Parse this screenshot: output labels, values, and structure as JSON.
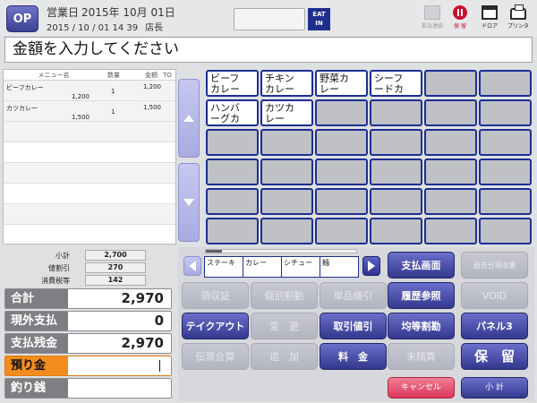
{
  "header": {
    "op_label": "OP",
    "business_day_label": "営業日",
    "business_day_value": "2015年 10月 01日",
    "datetime": "2015 / 10 / 01  14  39",
    "clerk_label": "店長",
    "eat_in_label": "EAT IN",
    "icons": [
      {
        "name": "emergency-contact",
        "label": "緊急連絡"
      },
      {
        "name": "hold",
        "label": "保 留"
      },
      {
        "name": "drawer",
        "label": "ドロア"
      },
      {
        "name": "printer",
        "label": "プリンタ"
      }
    ]
  },
  "prompt": "金額を入力してください",
  "order_list": {
    "columns": {
      "name": "メニュー名",
      "qty": "数量",
      "amount": "金額",
      "to": "TO"
    },
    "items": [
      {
        "name": "ビーフカレー",
        "unit_price": "1,200",
        "qty": "1",
        "amount": "1,200"
      },
      {
        "name": "カツカレー",
        "unit_price": "1,500",
        "qty": "1",
        "amount": "1,500"
      }
    ]
  },
  "menu_grid": {
    "items": [
      {
        "label": "ビーフ\nカレー"
      },
      {
        "label": "チキン\nカレー"
      },
      {
        "label": "野菜カ\nレー"
      },
      {
        "label": "シーフ\nードカ"
      },
      {
        "label": ""
      },
      {
        "label": ""
      },
      {
        "label": "ハンバ\nーグカ"
      },
      {
        "label": "カツカ\nレー"
      },
      {
        "label": ""
      },
      {
        "label": ""
      },
      {
        "label": ""
      },
      {
        "label": ""
      },
      {
        "label": ""
      },
      {
        "label": ""
      },
      {
        "label": ""
      },
      {
        "label": ""
      },
      {
        "label": ""
      },
      {
        "label": ""
      },
      {
        "label": ""
      },
      {
        "label": ""
      },
      {
        "label": ""
      },
      {
        "label": ""
      },
      {
        "label": ""
      },
      {
        "label": ""
      },
      {
        "label": ""
      },
      {
        "label": ""
      },
      {
        "label": ""
      },
      {
        "label": ""
      },
      {
        "label": ""
      },
      {
        "label": ""
      },
      {
        "label": ""
      },
      {
        "label": ""
      },
      {
        "label": ""
      },
      {
        "label": ""
      },
      {
        "label": ""
      },
      {
        "label": ""
      }
    ]
  },
  "summary": {
    "subtotal_label": "小計",
    "subtotal": "2,700",
    "discount_label": "値割引",
    "discount": "270",
    "tax_label": "消費税等",
    "tax": "142"
  },
  "totals": {
    "total_label": "合計",
    "total": "2,970",
    "non_cash_label": "現外支払",
    "non_cash": "0",
    "balance_label": "支払残金",
    "balance": "2,970",
    "deposit_label": "預り金",
    "deposit": "",
    "change_label": "釣り銭",
    "change": ""
  },
  "categories": [
    "ステーキ",
    "カレー",
    "シチュー",
    "麺"
  ],
  "buttons": {
    "payment_screen": "支払画面",
    "past_split": "過去分領収書",
    "receipt": "領収証",
    "individual_discount": "個別割勤",
    "item_discount": "単品値引",
    "history": "履歴参照",
    "void": "VOID",
    "takeout": "テイクアウト",
    "change_item": "変　更",
    "subtotal_discount": "取引値引",
    "equal_split": "均等割勘",
    "panel3": "パネル3",
    "slip_total": "伝票合算",
    "add": "追　加",
    "fee": "料　金",
    "unsettled": "未精算",
    "hold": "保　留",
    "cancel": "キャンセル",
    "subtotal_btn": "小 計"
  },
  "colors": {
    "active_button": "#33388f",
    "accent_orange": "#f28c1c",
    "cancel_red": "#d9375a",
    "grid_border": "#1c2f94"
  }
}
